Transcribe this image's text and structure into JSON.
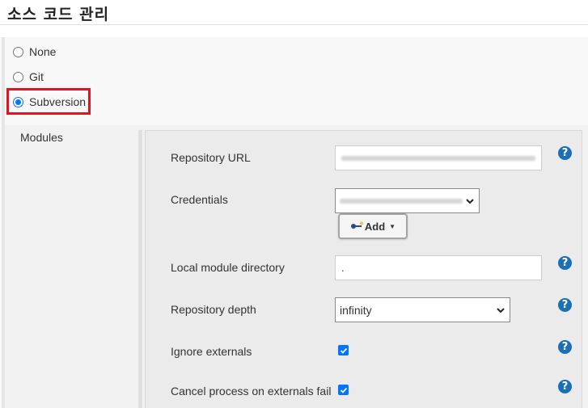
{
  "section": {
    "title": "소스 코드 관리"
  },
  "scm_options": [
    {
      "label": "None",
      "selected": false
    },
    {
      "label": "Git",
      "selected": false
    },
    {
      "label": "Subversion",
      "selected": true
    }
  ],
  "modules": {
    "label": "Modules",
    "repository_url": {
      "label": "Repository URL",
      "value": ""
    },
    "credentials": {
      "label": "Credentials",
      "selected": "",
      "add_label": "Add"
    },
    "local_module_directory": {
      "label": "Local module directory",
      "value": "."
    },
    "repository_depth": {
      "label": "Repository depth",
      "selected": "infinity"
    },
    "ignore_externals": {
      "label": "Ignore externals",
      "checked": true
    },
    "cancel_process": {
      "label": "Cancel process on externals fail",
      "checked": true
    }
  },
  "icons": {
    "help": "help-icon",
    "key": "key-icon",
    "caret": "caret-down-icon",
    "check": "check-icon"
  },
  "colors": {
    "highlight": "#e0141e",
    "accent": "#0075ff",
    "help": "#1a6fb5"
  }
}
